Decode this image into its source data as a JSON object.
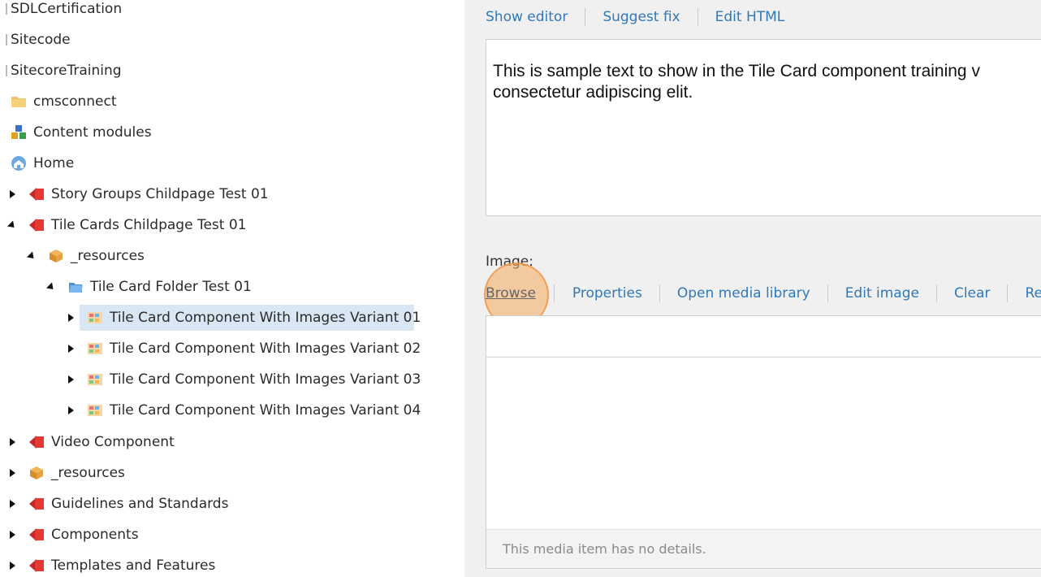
{
  "tree": {
    "items": [
      {
        "label": "SDLCertification",
        "depth": 0
      },
      {
        "label": "Sitecode",
        "depth": 0
      },
      {
        "label": "SitecoreTraining",
        "depth": 0
      },
      {
        "label": "cmsconnect",
        "icon": "folder-icon"
      },
      {
        "label": "Content modules",
        "icon": "modules-icon"
      },
      {
        "label": "Home",
        "icon": "home-icon"
      },
      {
        "label": "Story Groups Childpage Test 01",
        "icon": "page-icon",
        "expanded": false
      },
      {
        "label": "Tile Cards Childpage Test 01",
        "icon": "page-icon",
        "expanded": true
      },
      {
        "label": "_resources",
        "icon": "resources-icon",
        "expanded": true
      },
      {
        "label": "Tile Card Folder Test 01",
        "icon": "blue-folder-icon",
        "expanded": true
      },
      {
        "label": "Tile Card Component With Images Variant 01",
        "icon": "component-icon",
        "selected": true
      },
      {
        "label": "Tile Card Component With Images Variant 02",
        "icon": "component-icon"
      },
      {
        "label": "Tile Card Component With Images Variant 03",
        "icon": "component-icon"
      },
      {
        "label": "Tile Card Component With Images Variant 04",
        "icon": "component-icon"
      },
      {
        "label": "Video Component",
        "icon": "page-icon"
      },
      {
        "label": "_resources",
        "icon": "resources-icon"
      },
      {
        "label": "Guidelines and Standards",
        "icon": "page-icon"
      },
      {
        "label": "Components",
        "icon": "page-icon"
      },
      {
        "label": "Templates and Features",
        "icon": "page-icon"
      }
    ]
  },
  "editor": {
    "text_toolbar": {
      "show_editor": "Show editor",
      "suggest_fix": "Suggest fix",
      "edit_html": "Edit HTML"
    },
    "rich_text": "This is sample text to show in the Tile Card component training v consectetur adipiscing elit.",
    "image_label": "Image:",
    "image_toolbar": {
      "browse": "Browse",
      "properties": "Properties",
      "open_media_library": "Open media library",
      "edit_image": "Edit image",
      "clear": "Clear",
      "truncated": "Re"
    },
    "media_details": "This media item has no details."
  },
  "colors": {
    "link": "#2f79b9",
    "selection": "#d9e7f4",
    "editor_bg": "#f0f0f0",
    "click_indicator": "#f6aa5f"
  }
}
